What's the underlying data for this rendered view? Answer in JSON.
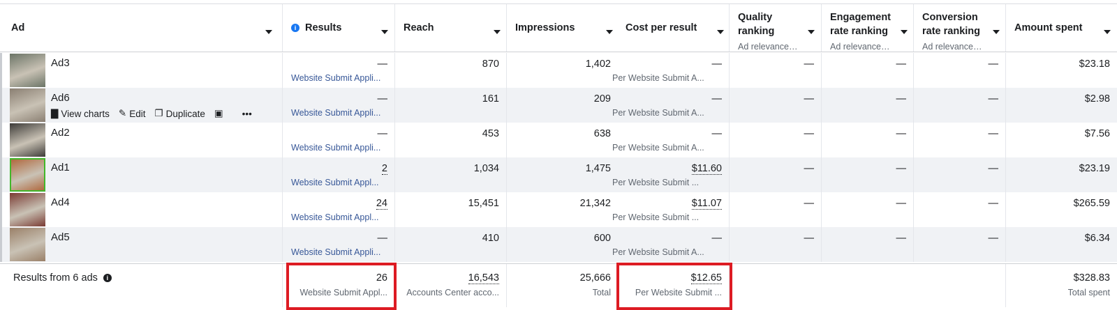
{
  "columns": {
    "ad": "Ad",
    "results": "Results",
    "reach": "Reach",
    "impressions": "Impressions",
    "cost_per_result": "Cost per result",
    "quality_ranking": "Quality ranking",
    "quality_sub": "Ad relevance…",
    "engagement_ranking": "Engagement rate ranking",
    "engagement_sub": "Ad relevance…",
    "conversion_ranking": "Conversion rate ranking",
    "conversion_sub": "Ad relevance…",
    "amount_spent": "Amount spent"
  },
  "row_actions": {
    "view_charts": "View charts",
    "edit": "Edit",
    "duplicate": "Duplicate",
    "more": "•••"
  },
  "rows": [
    {
      "name": "Ad3",
      "results": "—",
      "results_type": "Website Submit Appli...",
      "reach": "870",
      "impressions": "1,402",
      "cost": "—",
      "cost_type": "Per Website Submit A...",
      "quality": "—",
      "engagement": "—",
      "conversion": "—",
      "spent": "$23.18",
      "thumb_color": "#6b7466"
    },
    {
      "name": "Ad6",
      "results": "—",
      "results_type": "Website Submit Appli...",
      "reach": "161",
      "impressions": "209",
      "cost": "—",
      "cost_type": "Per Website Submit A...",
      "quality": "—",
      "engagement": "—",
      "conversion": "—",
      "spent": "$2.98",
      "thumb_color": "#8a7f72"
    },
    {
      "name": "Ad2",
      "results": "—",
      "results_type": "Website Submit Appli...",
      "reach": "453",
      "impressions": "638",
      "cost": "—",
      "cost_type": "Per Website Submit A...",
      "quality": "—",
      "engagement": "—",
      "conversion": "—",
      "spent": "$7.56",
      "thumb_color": "#3d3b38"
    },
    {
      "name": "Ad1",
      "results": "2",
      "results_type": "Website Submit Appl...",
      "reach": "1,034",
      "impressions": "1,475",
      "cost": "$11.60",
      "cost_type": "Per Website Submit ...",
      "quality": "—",
      "engagement": "—",
      "conversion": "—",
      "spent": "$23.19",
      "thumb_color": "#b06a3f"
    },
    {
      "name": "Ad4",
      "results": "24",
      "results_type": "Website Submit Appl...",
      "reach": "15,451",
      "impressions": "21,342",
      "cost": "$11.07",
      "cost_type": "Per Website Submit ...",
      "quality": "—",
      "engagement": "—",
      "conversion": "—",
      "spent": "$265.59",
      "thumb_color": "#7a3b33"
    },
    {
      "name": "Ad5",
      "results": "—",
      "results_type": "Website Submit Appli...",
      "reach": "410",
      "impressions": "600",
      "cost": "—",
      "cost_type": "Per Website Submit A...",
      "quality": "—",
      "engagement": "—",
      "conversion": "—",
      "spent": "$6.34",
      "thumb_color": "#9a8068"
    }
  ],
  "footer": {
    "label": "Results from 6 ads",
    "results": "26",
    "results_sub": "Website Submit Appl...",
    "reach": "16,543",
    "reach_sub": "Accounts Center acco...",
    "impressions": "25,666",
    "impressions_sub": "Total",
    "cost": "$12.65",
    "cost_sub": "Per Website Submit ...",
    "spent": "$328.83",
    "spent_sub": "Total spent"
  },
  "colors": {
    "highlight": "#dd1b23",
    "link_blue": "#385898",
    "info_blue": "#1877f2"
  }
}
